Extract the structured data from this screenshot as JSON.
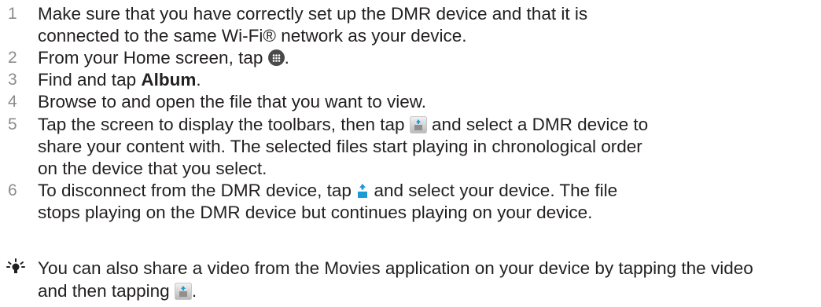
{
  "steps": [
    {
      "number": "1",
      "lines": [
        "Make sure that you have correctly set up the DMR device and that it is",
        "connected to the same Wi-Fi® network as your device."
      ]
    },
    {
      "number": "2",
      "before_icon": "From your Home screen, tap ",
      "icon": "apps-grid-icon",
      "after_icon": "."
    },
    {
      "number": "3",
      "before_bold": "Find and tap ",
      "bold": "Album",
      "after_bold": "."
    },
    {
      "number": "4",
      "text": "Browse to and open the file that you want to view."
    },
    {
      "number": "5",
      "line1_before_icon": "Tap the screen to display the toolbars, then tap ",
      "icon": "throw-icon",
      "line1_after_icon": " and select a DMR device to",
      "lines_rest": [
        "share your content with. The selected files start playing in chronological order",
        "on the device that you select."
      ]
    },
    {
      "number": "6",
      "line1_before_icon": "To disconnect from the DMR device, tap ",
      "icon": "throw-active-icon",
      "line1_after_icon": " and select your device. The file",
      "line2": "stops playing on the DMR device but continues playing on your device."
    }
  ],
  "tip": {
    "icon": "lightbulb-icon",
    "line1": "You can also share a video from the Movies application on your device by tapping the video",
    "line2_before_icon": "and then tapping ",
    "icon2": "throw-icon",
    "line2_after_icon": "."
  },
  "colors": {
    "text": "#231f20",
    "step_number": "#8c8c8c",
    "icon_dark": "#4a4a4a",
    "icon_blue": "#1a9ad6"
  }
}
